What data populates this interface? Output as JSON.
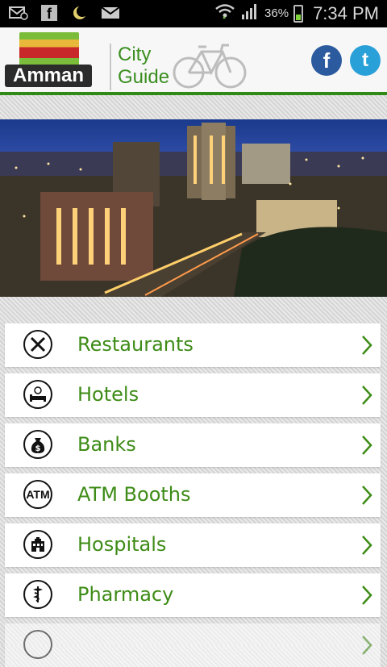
{
  "status_bar": {
    "battery_percent": "36%",
    "time": "7:34 PM",
    "icons": [
      "email-with-at-icon",
      "facebook-icon",
      "moon-icon",
      "mail-icon",
      "wifi-icon",
      "signal-icon",
      "battery-icon"
    ]
  },
  "header": {
    "logo_text": "Amman",
    "city_guide_line1": "City",
    "city_guide_line2": "Guide",
    "facebook_glyph": "f",
    "twitter_glyph": "t"
  },
  "menu": {
    "items": [
      {
        "label": "Restaurants",
        "icon": "fork-knife-icon"
      },
      {
        "label": "Hotels",
        "icon": "hotel-bed-icon"
      },
      {
        "label": "Banks",
        "icon": "money-bag-icon"
      },
      {
        "label": "ATM Booths",
        "icon": "atm-icon",
        "icon_text": "ATM"
      },
      {
        "label": "Hospitals",
        "icon": "hospital-icon"
      },
      {
        "label": "Pharmacy",
        "icon": "pharmacy-caduceus-icon"
      }
    ]
  },
  "colors": {
    "accent_green": "#3e8c17",
    "header_line": "#2f8a17",
    "facebook_blue": "#2b5a9e",
    "twitter_blue": "#2aa0d8"
  }
}
